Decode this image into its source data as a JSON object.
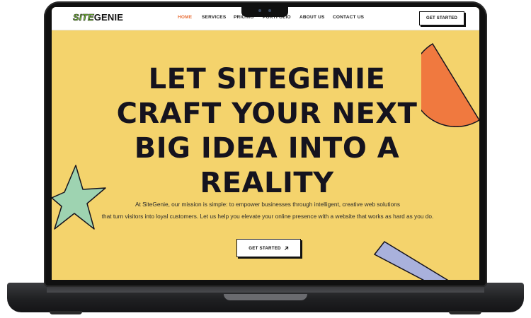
{
  "nav": {
    "logo_mark": "SITE",
    "logo_text": "GENIE",
    "links": [
      "HOME",
      "SERVICES",
      "PRICING",
      "PORTFOLIO",
      "ABOUT US",
      "CONTACT US"
    ],
    "active_link": "HOME",
    "cta_label": "GET STARTED"
  },
  "hero": {
    "title_lines": [
      "LET SITEGENIE",
      "CRAFT YOUR NEXT",
      "BIG IDEA INTO A",
      "REALITY"
    ],
    "description_lines": [
      "At SiteGenie, our mission is simple: to empower businesses through intelligent, creative web solutions",
      "that turn visitors into loyal customers. Let us help you elevate your online presence with a website that works as hard as you do."
    ],
    "cta_label": "GET STARTED",
    "cta_icon": "arrow-up-right-icon"
  },
  "colors": {
    "hero_background": "#f4d36c",
    "active_link": "#e8703a",
    "shape_orange": "#f0793f",
    "shape_green": "#9ed3b1",
    "shape_lavender": "#a9b1dc",
    "device": "#101010"
  }
}
